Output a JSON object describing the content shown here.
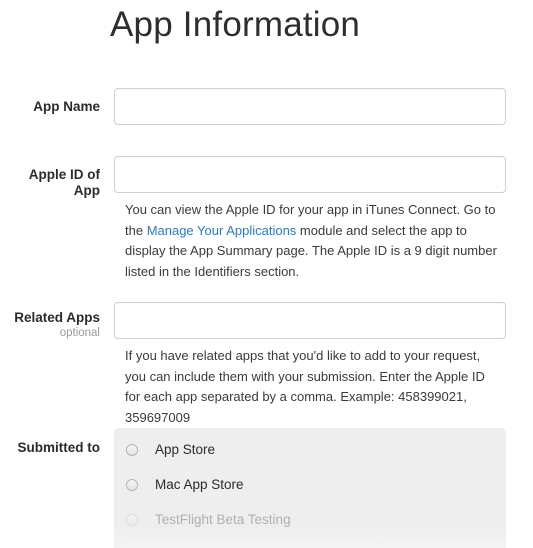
{
  "page": {
    "title": "App Information"
  },
  "fields": {
    "app_name": {
      "label": "App Name",
      "value": "",
      "placeholder": ""
    },
    "apple_id": {
      "label": "Apple ID of App",
      "value": "",
      "placeholder": "",
      "help_prefix": "You can view the Apple ID for your app in iTunes Connect. Go to the ",
      "help_link": "Manage Your Applications",
      "help_suffix": " module and select the app to display the App Summary page. The Apple ID is a 9 digit number listed in the Identifiers section."
    },
    "related_apps": {
      "label": "Related Apps",
      "sublabel": "optional",
      "value": "",
      "placeholder": "",
      "help": "If you have related apps that you'd like to add to your request, you can include them with your submission. Enter the Apple ID for each app separated by a comma. Example: 458399021, 359697009"
    },
    "submitted_to": {
      "label": "Submitted to",
      "options": [
        {
          "label": "App Store",
          "selected": false,
          "disabled": false
        },
        {
          "label": "Mac App Store",
          "selected": false,
          "disabled": false
        },
        {
          "label": "TestFlight Beta Testing",
          "selected": false,
          "disabled": true
        }
      ]
    }
  },
  "colors": {
    "link": "#2b7ac4",
    "panel_bg": "#eeeeee",
    "label_text": "#2b2b2b",
    "muted_text": "#9a9a9a"
  }
}
